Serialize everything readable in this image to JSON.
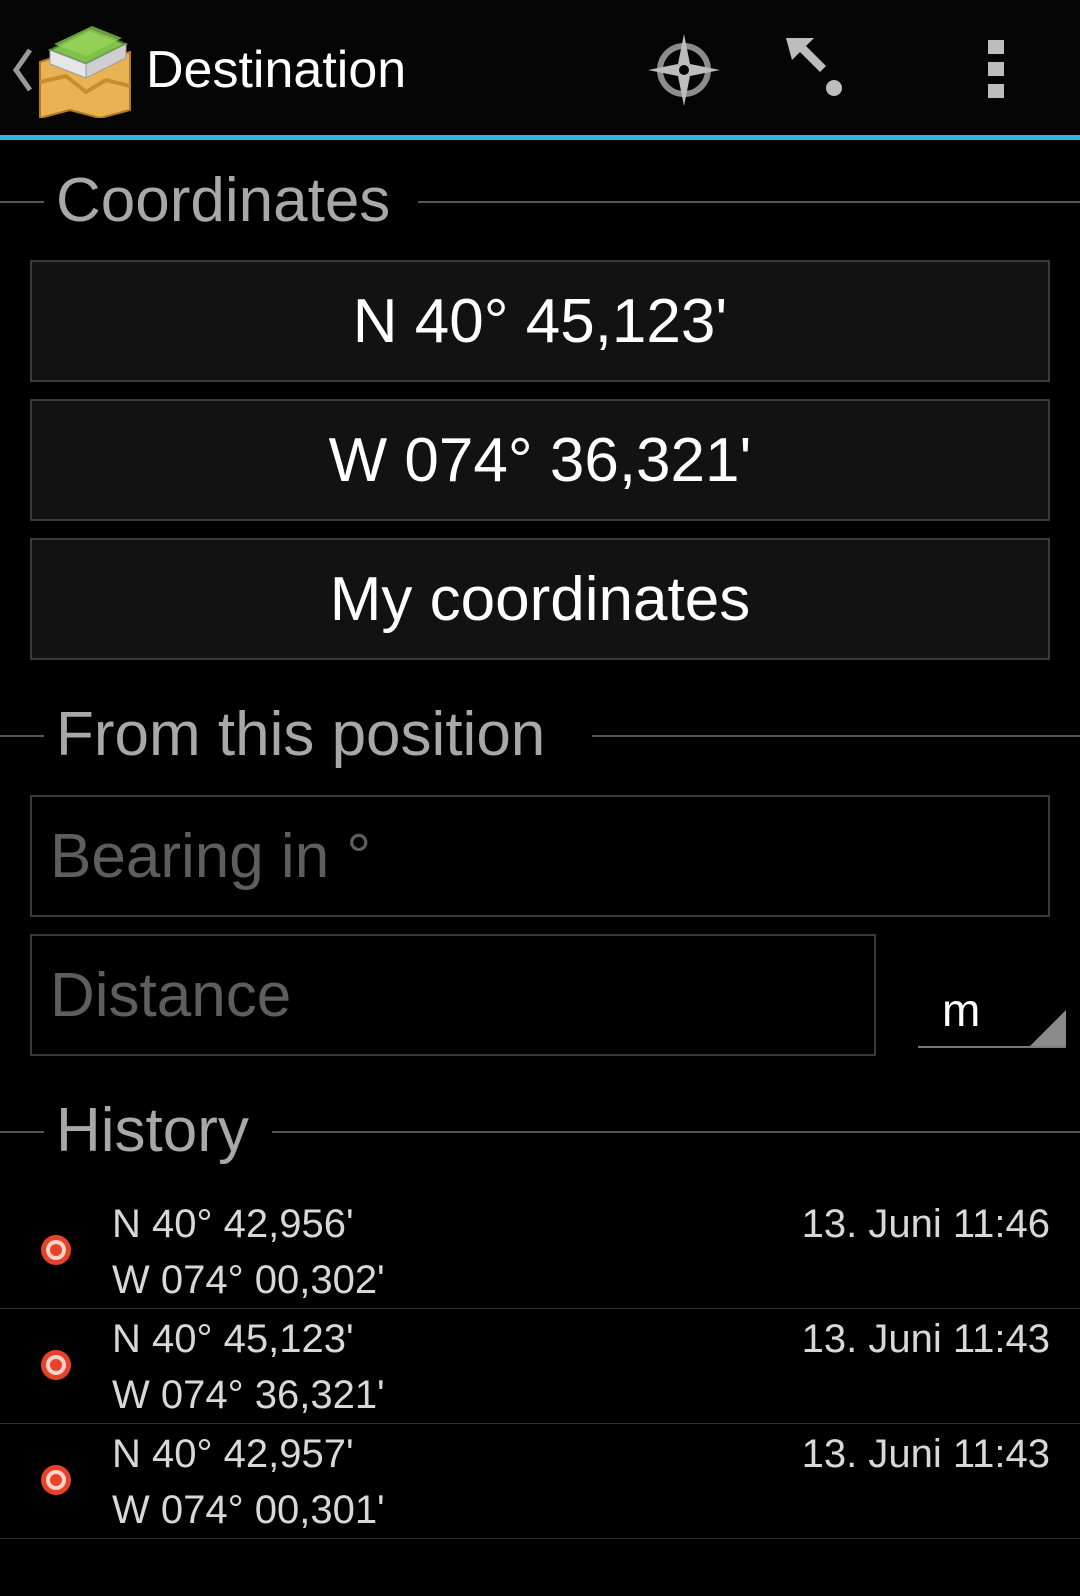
{
  "actionbar": {
    "title": "Destination",
    "icons": [
      "up-chevron-icon",
      "app-map-icon",
      "compass-icon",
      "target-arrow-icon",
      "overflow-menu-icon"
    ],
    "accent_color": "#33b5e5"
  },
  "sections": {
    "coordinates": "Coordinates",
    "from_position": "From this position",
    "history": "History"
  },
  "coordinates": {
    "latitude": "N 40° 45,123'",
    "longitude": "W 074° 36,321'",
    "my_coordinates": "My coordinates"
  },
  "projection": {
    "bearing_value": "",
    "bearing_placeholder": "Bearing in °",
    "distance_value": "",
    "distance_placeholder": "Distance",
    "unit": "m"
  },
  "history": [
    {
      "lat": "N 40° 42,956'",
      "lon": "W 074° 00,302'",
      "time": "13. Juni 11:46"
    },
    {
      "lat": "N 40° 45,123'",
      "lon": "W 074° 36,321'",
      "time": "13. Juni 11:43"
    },
    {
      "lat": "N 40° 42,957'",
      "lon": "W 074° 00,301'",
      "time": "13. Juni 11:43"
    }
  ],
  "colors": {
    "history_marker": "#e8432a"
  }
}
